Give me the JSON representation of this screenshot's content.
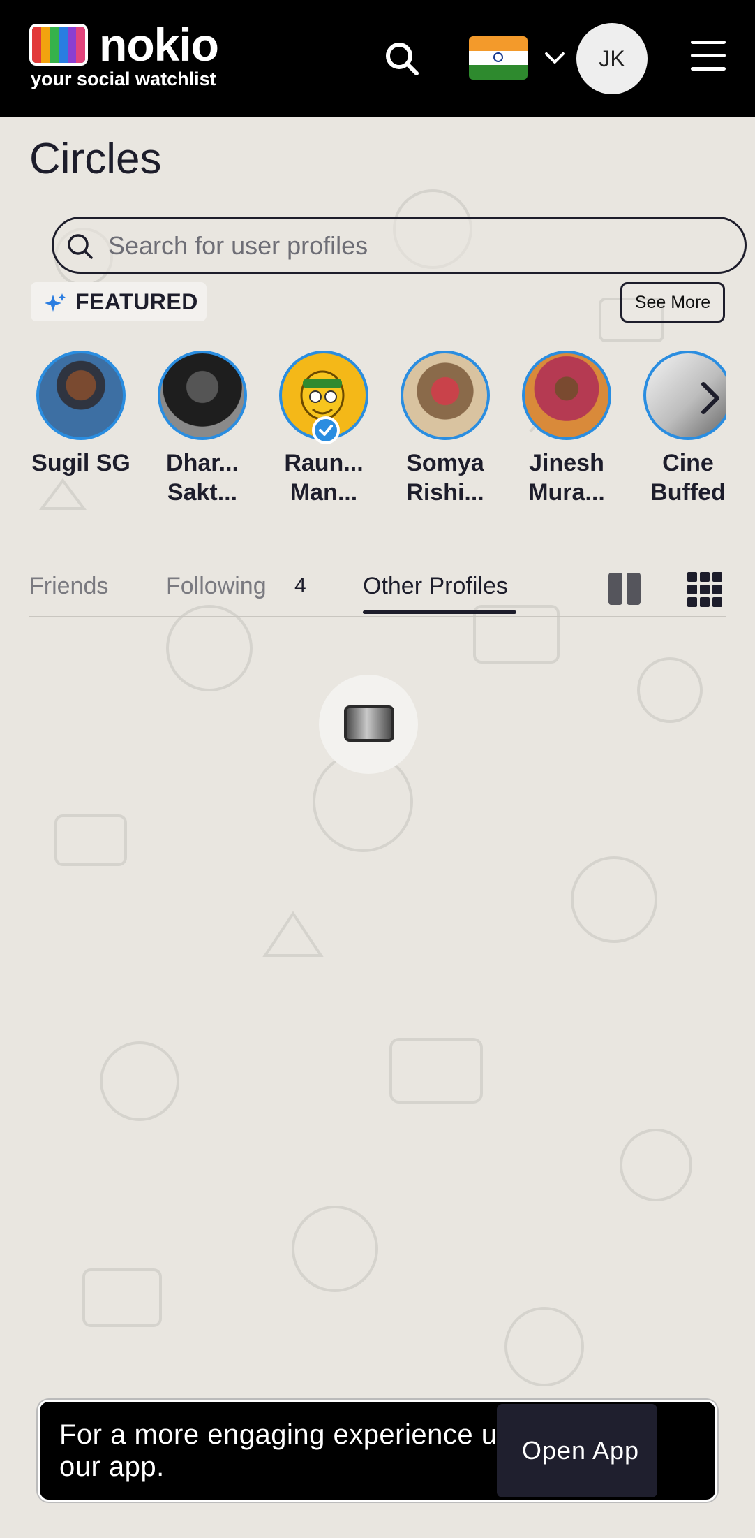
{
  "header": {
    "logo_word": "nokio",
    "logo_tagline": "your social watchlist",
    "avatar_initials": "JK"
  },
  "page": {
    "title": "Circles"
  },
  "search": {
    "placeholder": "Search for user profiles",
    "value": ""
  },
  "featured": {
    "label": "FEATURED",
    "see_more": "See More",
    "profiles": [
      {
        "name": "Sugil SG",
        "verified": false
      },
      {
        "name": "Dhar... Sakt...",
        "verified": false
      },
      {
        "name": "Raun... Man...",
        "verified": true
      },
      {
        "name": "Somya Rishi...",
        "verified": false
      },
      {
        "name": "Jinesh Mura...",
        "verified": false
      },
      {
        "name": "Cine Buffed",
        "verified": false
      }
    ]
  },
  "tabs": {
    "friends": "Friends",
    "following": "Following",
    "following_count": "4",
    "other_profiles": "Other Profiles",
    "active": "other_profiles"
  },
  "icons": {
    "search": "search-icon",
    "menu": "hamburger-menu-icon",
    "flag": "india-flag-icon",
    "sparkle": "sparkle-icon",
    "next": "chevron-right-icon",
    "view_large": "two-column-grid-icon",
    "view_small": "three-column-grid-icon",
    "loader": "tv-loading-icon"
  },
  "banner": {
    "text": "For a more engaging experience use our app.",
    "button": "Open App"
  },
  "colors": {
    "accent_ring": "#2a8de0",
    "header_bg": "#000000",
    "page_bg": "#e9e6e0",
    "text_dark": "#1d1d2b"
  }
}
